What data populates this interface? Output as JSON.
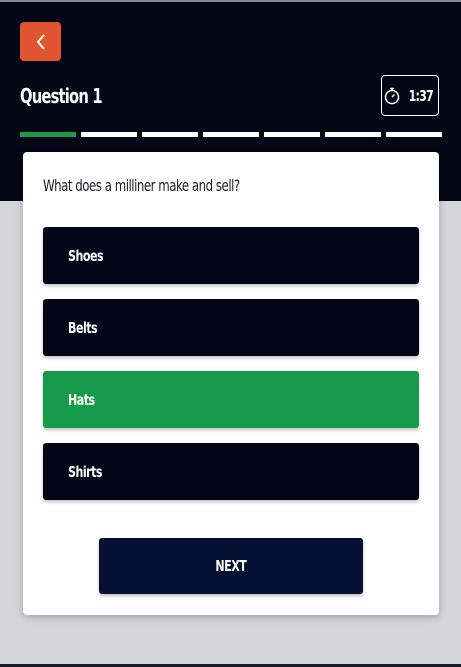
{
  "header": {
    "title": "Question 1",
    "timer": "1:37",
    "progress": {
      "total_segments": 7,
      "current_segment": 1
    },
    "colors": {
      "background": "#060616",
      "back_button": "#e0552f",
      "progress_active": "#1a9a4a"
    },
    "icons": {
      "back": "chevron-left-icon",
      "timer": "stopwatch-icon"
    }
  },
  "quiz": {
    "question": "What does a milliner make and sell?",
    "options": [
      {
        "label": "Shoes",
        "state": "default"
      },
      {
        "label": "Belts",
        "state": "default"
      },
      {
        "label": "Hats",
        "state": "correct"
      },
      {
        "label": "Shirts",
        "state": "default"
      }
    ],
    "next_label": "NEXT",
    "colors": {
      "option": "#05051a",
      "correct": "#179a4b",
      "next_button": "#051133"
    }
  }
}
